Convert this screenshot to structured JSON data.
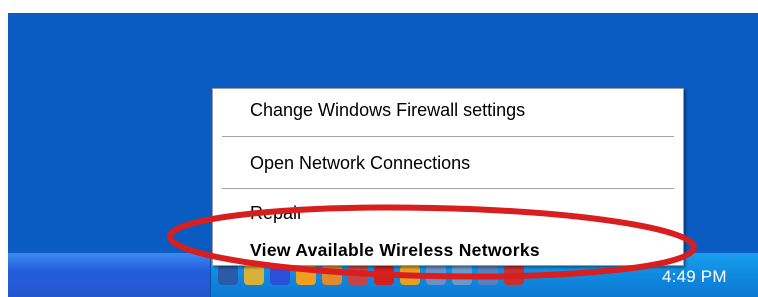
{
  "menu": {
    "items": [
      {
        "label": "Change Windows Firewall settings"
      },
      {
        "label": "Open Network Connections"
      },
      {
        "label": "Repair"
      },
      {
        "label": "View Available Wireless Networks"
      }
    ]
  },
  "tray": {
    "clock": "4:49 PM",
    "icons": [
      {
        "name": "network-disconnected-icon",
        "color": "#2a5aa8"
      },
      {
        "name": "volume-icon",
        "color": "#d8b03a"
      },
      {
        "name": "bluetooth-icon",
        "color": "#2a4fd8"
      },
      {
        "name": "messenger-icon",
        "color": "#f0a020"
      },
      {
        "name": "app-icon",
        "color": "#e08a30"
      },
      {
        "name": "app-icon-2",
        "color": "#c84444"
      },
      {
        "name": "antivirus-icon",
        "color": "#d02020"
      },
      {
        "name": "app-icon-3",
        "color": "#e8a020"
      },
      {
        "name": "app-icon-4",
        "color": "#6a90c8"
      },
      {
        "name": "app-icon-5",
        "color": "#6a9ac8"
      },
      {
        "name": "monitor-icon",
        "color": "#5a80c0"
      },
      {
        "name": "security-shield-icon",
        "color": "#c83030"
      }
    ]
  },
  "colors": {
    "highlight": "#d81e1e",
    "desktop": "#0a5cc2"
  }
}
